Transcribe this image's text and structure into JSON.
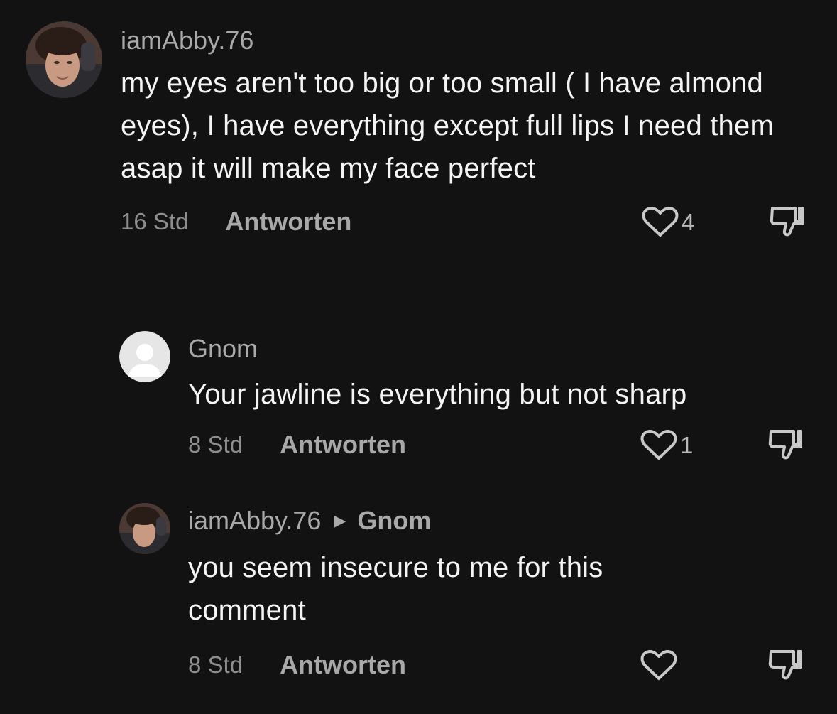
{
  "comments": [
    {
      "author": "iamAbby.76",
      "text": "my eyes aren't too big or too small ( I have almond eyes), I have everything except full lips I need them asap it will make my face perfect",
      "time": "16 Std",
      "reply_label": "Antworten",
      "likes": "4"
    },
    {
      "author": "Gnom",
      "text": "Your jawline is everything but not sharp",
      "time": "8 Std",
      "reply_label": "Antworten",
      "likes": "1"
    },
    {
      "author": "iamAbby.76",
      "reply_to": "Gnom",
      "text": "you seem insecure to me for this comment",
      "time": "8 Std",
      "reply_label": "Antworten",
      "likes": ""
    }
  ],
  "icons": {
    "like": "heart-outline-icon",
    "dislike": "thumbs-down-icon",
    "reply_arrow": "play-triangle-icon",
    "default_avatar": "user-silhouette-icon"
  },
  "colors": {
    "background": "#121212",
    "text": "#f4f4f4",
    "secondary": "#a9a9a9",
    "muted": "#8e8e8e"
  }
}
